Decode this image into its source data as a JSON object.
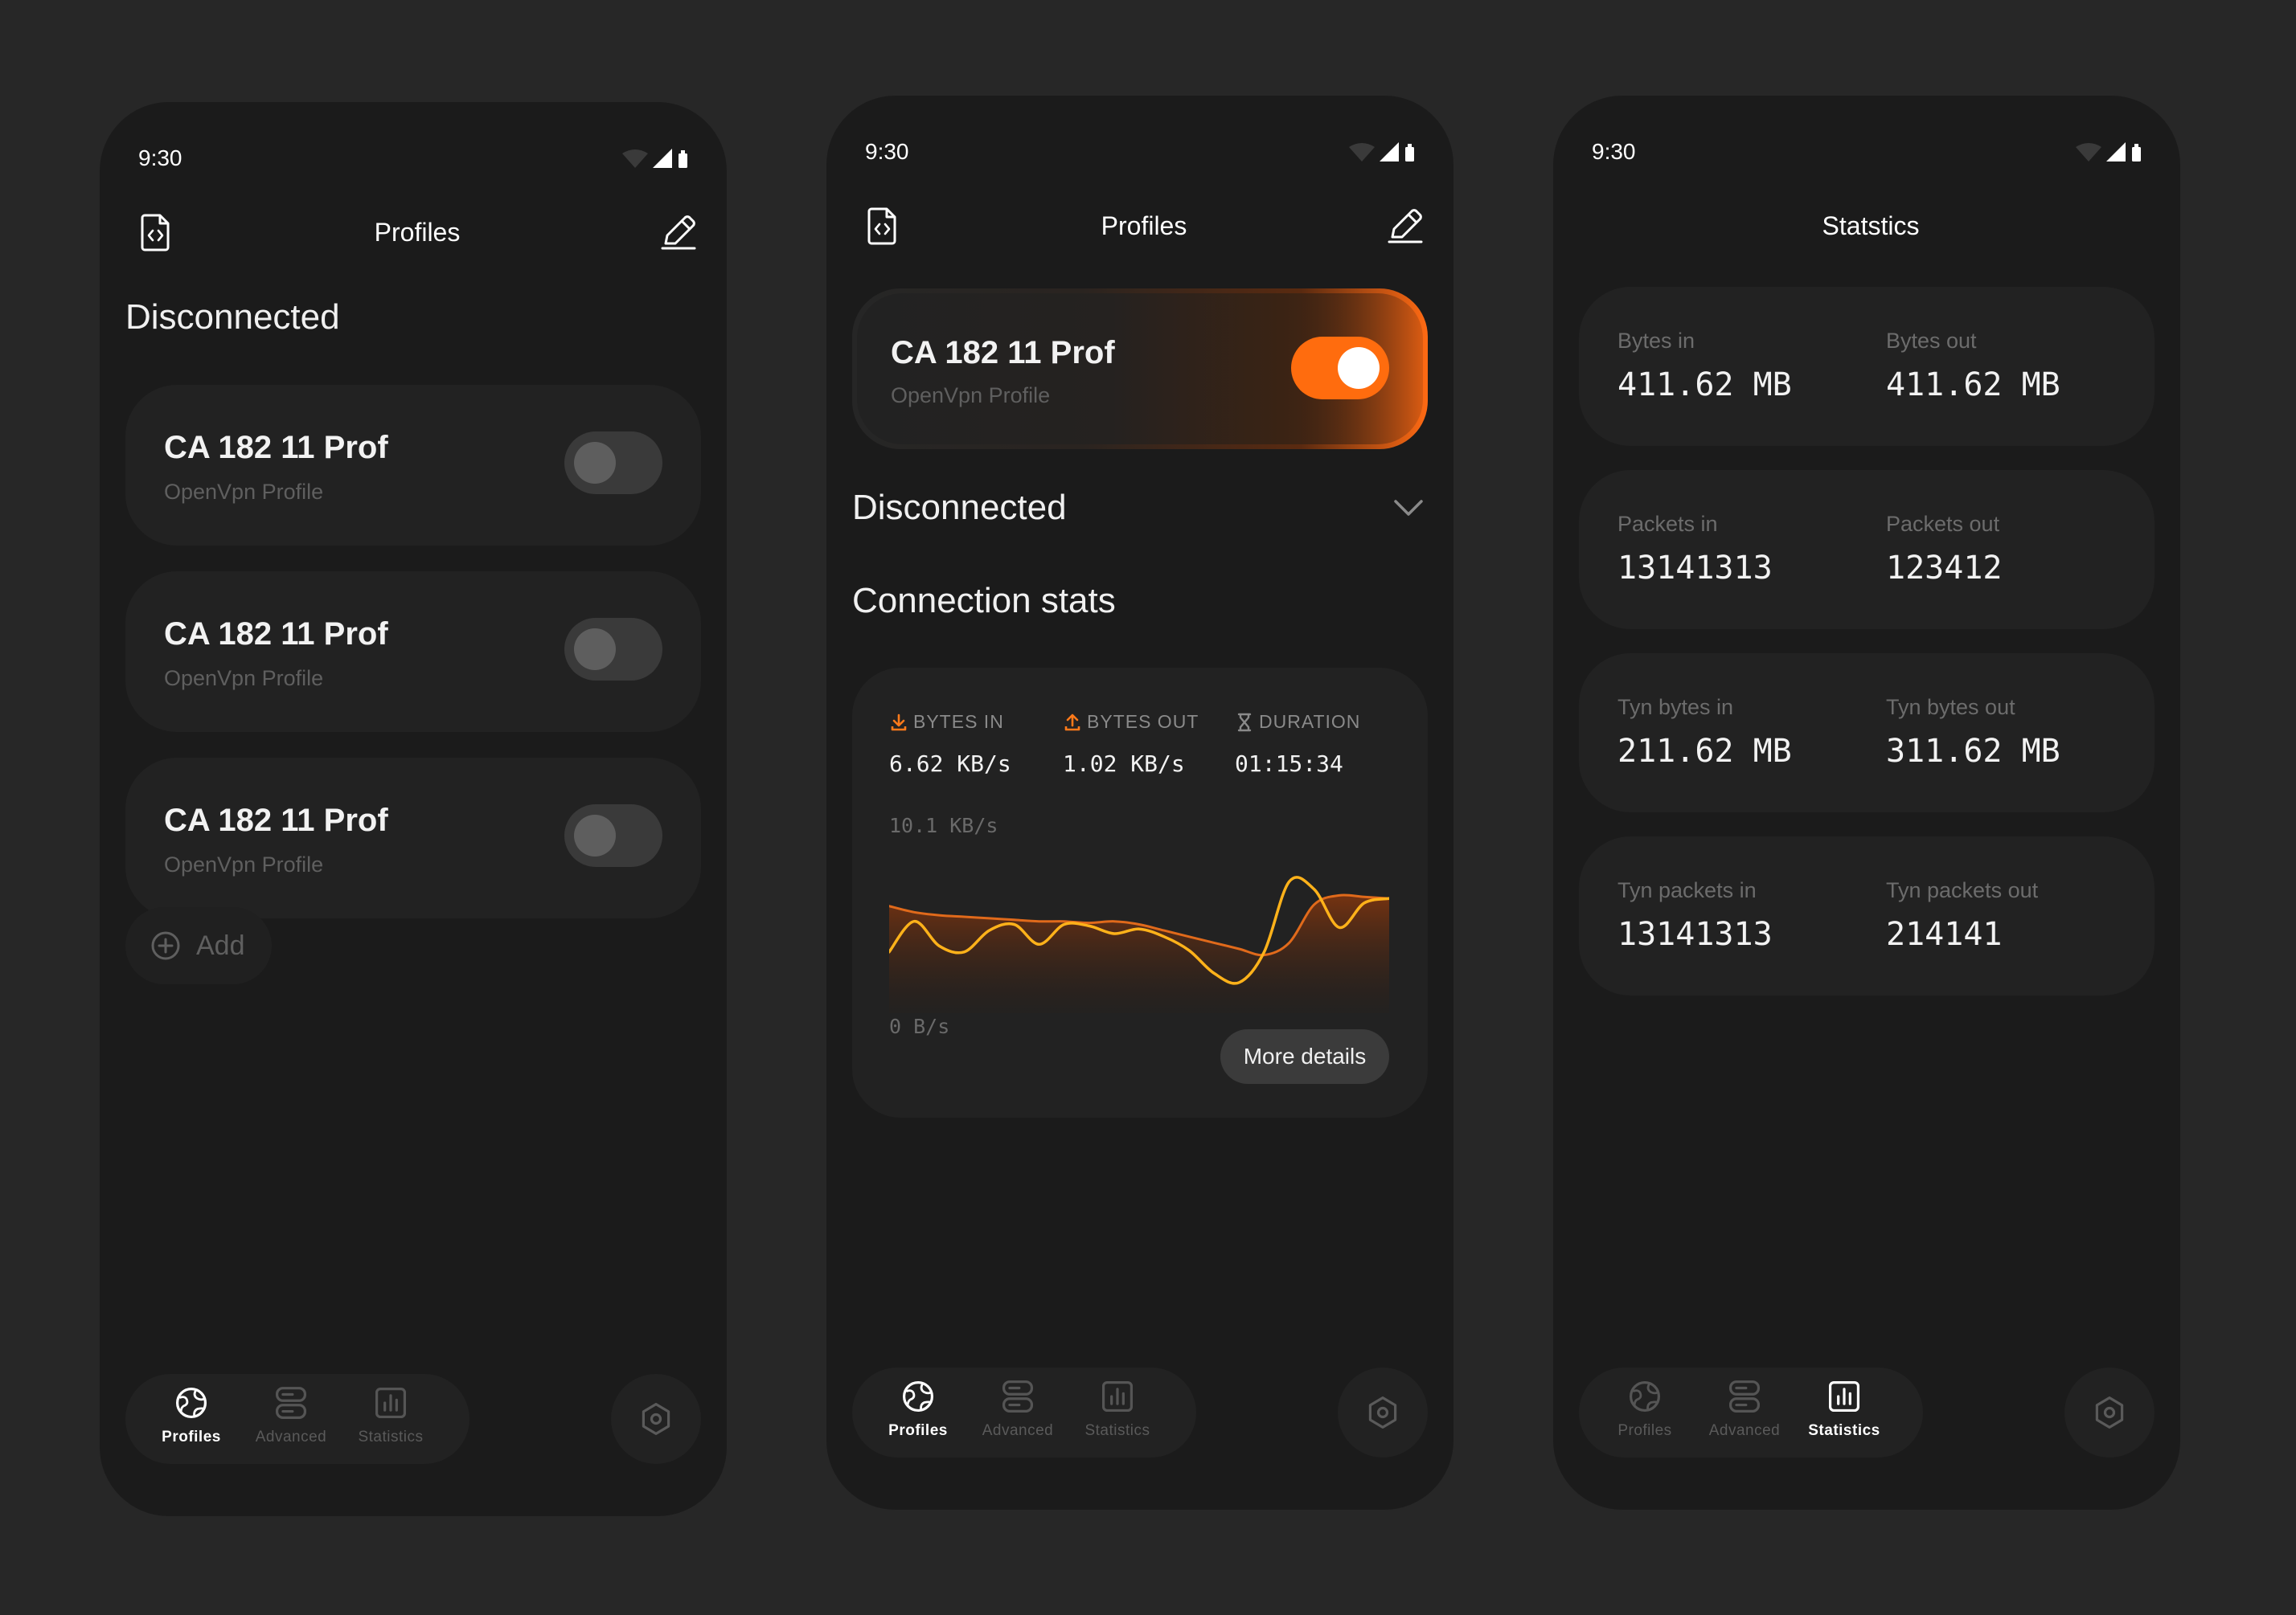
{
  "status_time": "9:30",
  "colors": {
    "background": "#272727",
    "phone": "#1b1b1b",
    "card": "#222222",
    "accent": "#ff6c0e"
  },
  "screen1": {
    "header": {
      "title": "Profiles",
      "left_icon": "file-code-icon",
      "right_icon": "edit-pen-icon"
    },
    "state_label": "Disconnected",
    "profiles": [
      {
        "name": "CA 182 11 Prof",
        "type": "OpenVpn Profile",
        "enabled": false
      },
      {
        "name": "CA 182 11 Prof",
        "type": "OpenVpn Profile",
        "enabled": false
      },
      {
        "name": "CA 182 11 Prof",
        "type": "OpenVpn Profile",
        "enabled": false
      }
    ],
    "add_label": "Add"
  },
  "screen2": {
    "header": {
      "title": "Profiles",
      "left_icon": "file-code-icon",
      "right_icon": "edit-pen-icon"
    },
    "active_profile": {
      "name": "CA 182 11 Prof",
      "type": "OpenVpn Profile",
      "enabled": true
    },
    "state_label": "Disconnected",
    "connection_stats_title": "Connection stats",
    "metrics": [
      {
        "label": "BYTES IN",
        "value": "6.62 KB/s",
        "icon": "download-icon"
      },
      {
        "label": "BYTES OUT",
        "value": "1.02 KB/s",
        "icon": "upload-icon"
      },
      {
        "label": "DURATION",
        "value": "01:15:34",
        "icon": "hourglass-icon"
      }
    ],
    "chart_max_label": "10.1 KB/s",
    "chart_min_label": "0 B/s",
    "more_details_label": "More details"
  },
  "chart_data": {
    "type": "line",
    "ylim": [
      0,
      10.1
    ],
    "yunit": "KB/s",
    "y_tick_labels": [
      "0 B/s",
      "10.1 KB/s"
    ],
    "x": [
      0,
      1,
      2,
      3,
      4,
      5,
      6,
      7,
      8,
      9,
      10,
      11,
      12,
      13,
      14,
      15,
      16,
      17,
      18,
      19,
      20
    ],
    "series": [
      {
        "color": "#e06a1b",
        "values": [
          6.8,
          6.4,
          6.2,
          6.1,
          6.0,
          5.9,
          5.8,
          5.8,
          5.7,
          5.8,
          5.6,
          5.2,
          4.8,
          4.4,
          4.0,
          3.6,
          4.4,
          6.9,
          7.5,
          7.4,
          7.3
        ]
      },
      {
        "color": "#ffb21a",
        "values": [
          3.8,
          5.8,
          4.2,
          3.8,
          5.2,
          5.6,
          4.3,
          5.6,
          5.5,
          5.0,
          5.3,
          4.8,
          3.9,
          2.4,
          1.8,
          3.8,
          8.4,
          7.9,
          5.4,
          7.0,
          7.3
        ]
      }
    ]
  },
  "screen3": {
    "header": {
      "title": "Statstics"
    },
    "stats": [
      {
        "left_label": "Bytes in",
        "left_value": "411.62 MB",
        "right_label": "Bytes out",
        "right_value": "411.62 MB"
      },
      {
        "left_label": "Packets in",
        "left_value": "13141313",
        "right_label": "Packets out",
        "right_value": "123412"
      },
      {
        "left_label": "Tyn bytes in",
        "left_value": "211.62 MB",
        "right_label": "Tyn bytes out",
        "right_value": "311.62 MB"
      },
      {
        "left_label": "Tyn packets in",
        "left_value": "13141313",
        "right_label": "Tyn packets out",
        "right_value": "214141"
      }
    ]
  },
  "nav": {
    "items": [
      {
        "label": "Profiles",
        "icon": "globe-icon"
      },
      {
        "label": "Advanced",
        "icon": "servers-icon"
      },
      {
        "label": "Statistics",
        "icon": "bar-chart-icon"
      }
    ],
    "settings_icon": "settings-hexagon-icon"
  }
}
